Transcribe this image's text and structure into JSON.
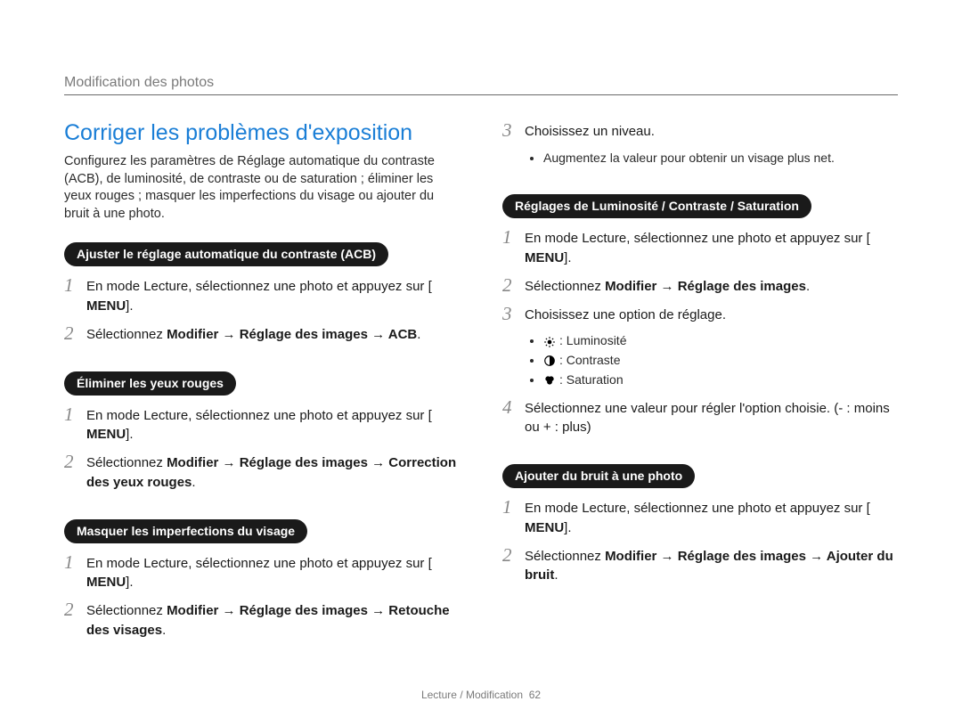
{
  "breadcrumb": "Modification des photos",
  "heading": "Corriger les problèmes d'exposition",
  "intro": "Configurez les paramètres de Réglage automatique du contraste (ACB), de luminosité, de contraste ou de saturation ; éliminer les yeux rouges ; masquer les imperfections du visage ou ajouter du bruit à une photo.",
  "acb": {
    "pill": "Ajuster le réglage automatique du contraste (ACB)",
    "s1_num": "1",
    "s1_a": "En mode Lecture, sélectionnez une photo et appuyez sur [",
    "s1_menu": "MENU",
    "s1_b": "].",
    "s2_num": "2",
    "s2_a": "Sélectionnez ",
    "s2_bold": "Modifier → Réglage des images → ACB",
    "s2_b": "."
  },
  "redeye": {
    "pill": "Éliminer les yeux rouges",
    "s1_num": "1",
    "s1_a": "En mode Lecture, sélectionnez une photo et appuyez sur [",
    "s1_menu": "MENU",
    "s1_b": "].",
    "s2_num": "2",
    "s2_a": "Sélectionnez ",
    "s2_bold1": "Modifier →  Réglage des images → Correction des yeux rouges",
    "s2_b": "."
  },
  "face": {
    "pill": "Masquer les imperfections du visage",
    "s1_num": "1",
    "s1_a": "En mode Lecture, sélectionnez une photo et appuyez sur [",
    "s1_menu": "MENU",
    "s1_b": "].",
    "s2_num": "2",
    "s2_a": "Sélectionnez ",
    "s2_bold1": "Modifier →  Réglage des images → Retouche des visages",
    "s2_b": "."
  },
  "face_cont": {
    "s3_num": "3",
    "s3_text": "Choisissez un niveau.",
    "s3_bullet": "Augmentez la valeur pour obtenir un visage plus net."
  },
  "lcs": {
    "pill": "Réglages de Luminosité / Contraste / Saturation",
    "s1_num": "1",
    "s1_a": "En mode Lecture, sélectionnez une photo et appuyez sur [",
    "s1_menu": "MENU",
    "s1_b": "].",
    "s2_num": "2",
    "s2_a": "Sélectionnez ",
    "s2_bold": "Modifier → Réglage des images",
    "s2_b": ".",
    "s3_num": "3",
    "s3_text": "Choisissez une option de réglage.",
    "b1": ": Luminosité",
    "b2": ": Contraste",
    "b3": ": Saturation",
    "s4_num": "4",
    "s4_text": "Sélectionnez une valeur pour régler l'option choisie. (- : moins ou + : plus)"
  },
  "noise": {
    "pill": "Ajouter du bruit à une photo",
    "s1_num": "1",
    "s1_a": "En mode Lecture, sélectionnez une photo et appuyez sur [",
    "s1_menu": "MENU",
    "s1_b": "].",
    "s2_num": "2",
    "s2_a": "Sélectionnez ",
    "s2_bold": "Modifier → Réglage des images → Ajouter du bruit",
    "s2_b": "."
  },
  "footer": {
    "section": "Lecture / Modification",
    "page": "62"
  }
}
